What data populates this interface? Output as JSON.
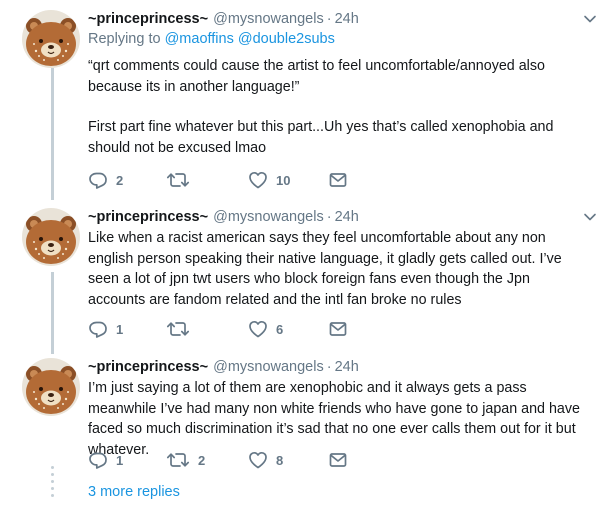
{
  "tweets": [
    {
      "name": "~princeprincess~",
      "handle": "@mysnowangels",
      "separator": "·",
      "time": "24h",
      "replying_prefix": "Replying to",
      "mentions": [
        "@maoffins",
        "@double2subs"
      ],
      "paragraphs": [
        "“qrt comments could cause the artist to feel uncomfortable/annoyed also because its in another language!”",
        "First part fine whatever but this part...Uh yes that’s called xenophobia and should not be excused lmao"
      ],
      "replies": "2",
      "retweets": "",
      "likes": "10"
    },
    {
      "name": "~princeprincess~",
      "handle": "@mysnowangels",
      "separator": "·",
      "time": "24h",
      "paragraphs": [
        "Like when a racist american says they feel uncomfortable about any non english person speaking their native language, it gladly gets called out. I’ve seen a lot of jpn twt users who block foreign fans even though the Jpn accounts are fandom related and the intl fan broke no rules"
      ],
      "replies": "1",
      "retweets": "",
      "likes": "6"
    },
    {
      "name": "~princeprincess~",
      "handle": "@mysnowangels",
      "separator": "·",
      "time": "24h",
      "paragraphs": [
        "I’m just saying a lot of them are xenophobic and it always gets a pass meanwhile I’ve had many non white friends who have gone to japan and have faced so much discrimination it’s sad that no one ever calls them out for it but whatever."
      ],
      "replies": "1",
      "retweets": "2",
      "likes": "8"
    }
  ],
  "more_replies": "3 more replies",
  "icons": {
    "reply": "speech-bubble-icon",
    "retweet": "retweet-arrows-icon",
    "like": "heart-outline-icon",
    "dm": "envelope-icon",
    "menu": "chevron-down-icon"
  },
  "colors": {
    "link": "#1b95e0",
    "secondary_text": "#657786",
    "thread_line": "#c4cfd6",
    "avatar_bg": "#b36b36"
  }
}
